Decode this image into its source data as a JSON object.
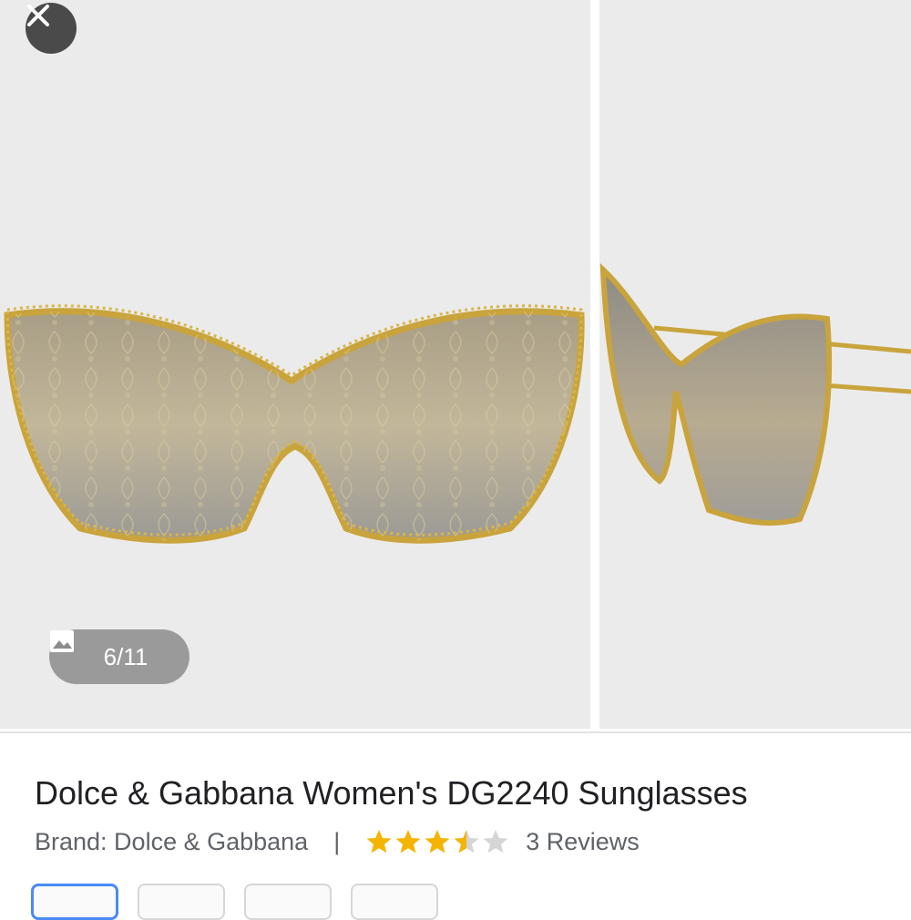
{
  "gallery": {
    "counter_text": "6/11",
    "counter_icon": "image-icon",
    "close_icon": "close-icon"
  },
  "product": {
    "title": "Dolce & Gabbana Women's DG2240 Sunglasses",
    "brand_label": "Brand: Dolce & Gabbana",
    "separator": "|",
    "rating": 3.5,
    "rating_max": 5,
    "reviews": "3 Reviews"
  },
  "thumbnails": {
    "count": 4,
    "selected_index": 0
  },
  "colors": {
    "star_filled": "#f4b400",
    "star_empty": "#d5d5d5",
    "thumb_active": "#4a8af4",
    "photo_bg": "#ebebeb"
  }
}
